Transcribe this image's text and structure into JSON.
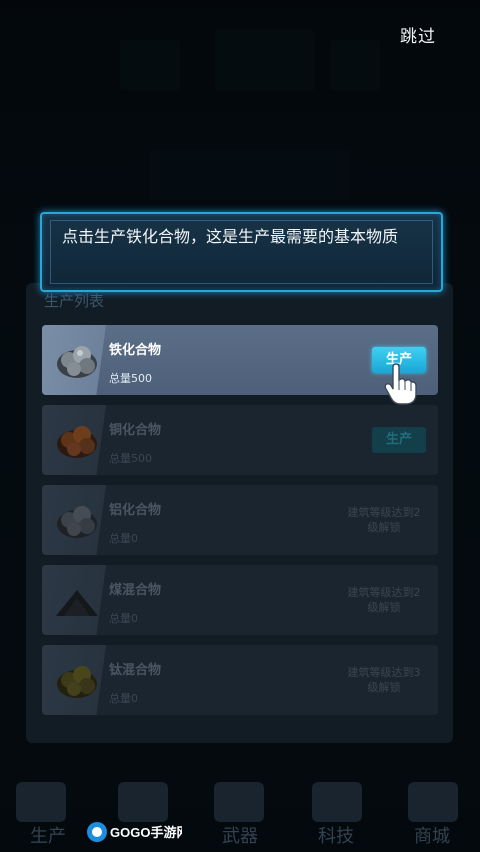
{
  "skip_label": "跳过",
  "tip_text": "点击生产铁化合物，这是生产最需要的基本物质",
  "panel_title": "生产列表",
  "items": [
    {
      "name": "铁化合物",
      "total": "总量500",
      "button": "生产",
      "ore_color": "#8a929a"
    },
    {
      "name": "铜化合物",
      "total": "总量500",
      "button": "生产",
      "ore_color": "#8a4a22"
    },
    {
      "name": "铝化合物",
      "total": "总量0",
      "lock_text": "建筑等级达到2级解锁",
      "ore_color": "#4a525a"
    },
    {
      "name": "煤混合物",
      "total": "总量0",
      "lock_text": "建筑等级达到2级解锁",
      "ore_color": "#1a1e22"
    },
    {
      "name": "钛混合物",
      "total": "总量0",
      "lock_text": "建筑等级达到3级解锁",
      "ore_color": "#4d4a22"
    }
  ],
  "nav": [
    "生产",
    "武器",
    "科技",
    "商城"
  ],
  "watermark": "GOGO手游网",
  "colors": {
    "accent": "#2aa7d8",
    "button": "#1ba5d5"
  }
}
